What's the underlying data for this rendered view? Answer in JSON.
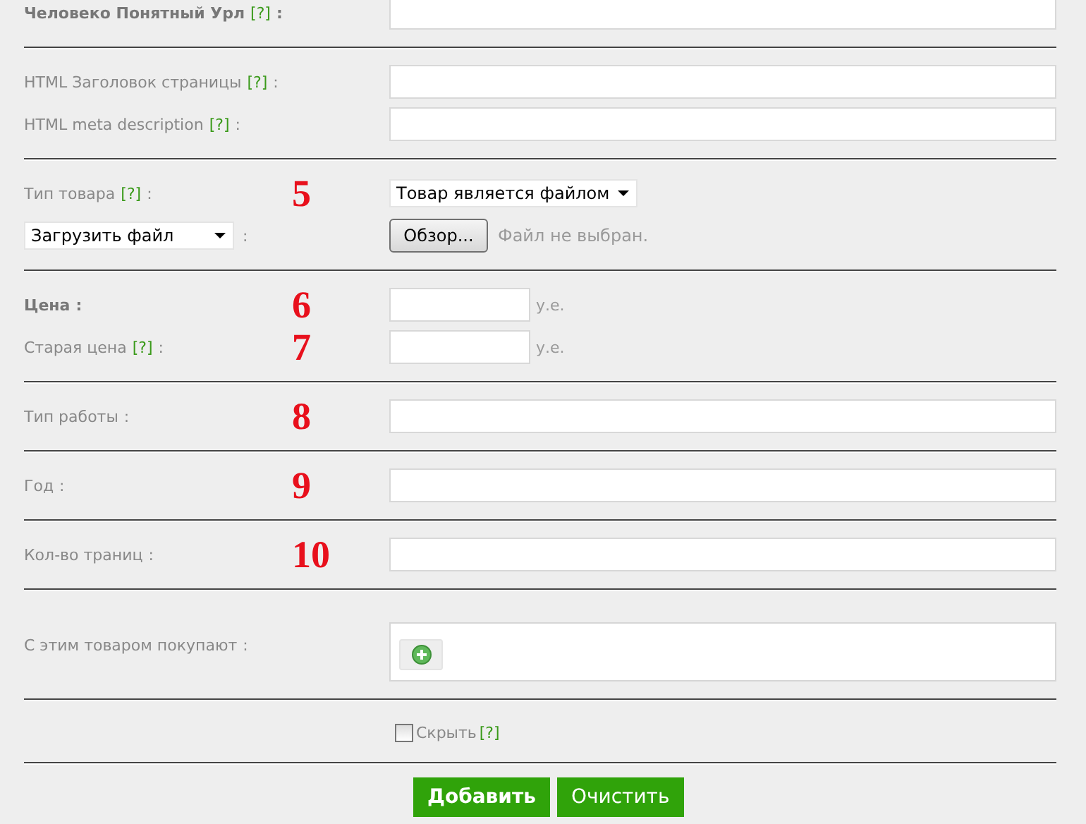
{
  "sections": [
    {
      "rows": [
        {
          "kind": "text",
          "label": "Человеко Понятный Урл",
          "bold": true,
          "help": "[?]",
          "suffix": ":"
        }
      ]
    },
    {
      "rows": [
        {
          "kind": "text",
          "label": "HTML Заголовок страницы",
          "help": "[?]",
          "suffix": ":"
        },
        {
          "kind": "text",
          "label": "HTML meta description",
          "help": "[?]",
          "suffix": ":"
        }
      ]
    },
    {
      "rows": [
        {
          "kind": "select",
          "label": "Тип товара",
          "help": "[?]",
          "suffix": ":",
          "annotation": "5",
          "value": "Товар является файлом"
        },
        {
          "kind": "file",
          "source": "Загрузить файл",
          "suffix": ":",
          "browse": "Обзор...",
          "status": "Файл не выбран."
        }
      ]
    },
    {
      "rows": [
        {
          "kind": "price",
          "label": "Цена",
          "bold": true,
          "suffix": ":",
          "annotation": "6",
          "unit": "у.е."
        },
        {
          "kind": "price",
          "label": "Старая цена",
          "help": "[?]",
          "suffix": ":",
          "annotation": "7",
          "unit": "у.е."
        }
      ]
    },
    {
      "rows": [
        {
          "kind": "text",
          "label": "Тип работы",
          "suffix": ":",
          "annotation": "8"
        }
      ]
    },
    {
      "rows": [
        {
          "kind": "text",
          "label": "Год",
          "suffix": ":",
          "annotation": "9"
        }
      ]
    },
    {
      "rows": [
        {
          "kind": "text",
          "label": "Кол-во траниц",
          "suffix": ":",
          "annotation": "10"
        }
      ]
    },
    {
      "rows": [
        {
          "kind": "related",
          "label": "С этим товаром покупают",
          "suffix": ":"
        }
      ]
    },
    {
      "rows": [
        {
          "kind": "checkbox",
          "label": "Скрыть",
          "help": "[?]",
          "checked": false
        }
      ]
    }
  ],
  "buttons": [
    {
      "label": "Добавить",
      "kind": "submit"
    },
    {
      "label": "Очистить",
      "kind": "reset"
    }
  ]
}
